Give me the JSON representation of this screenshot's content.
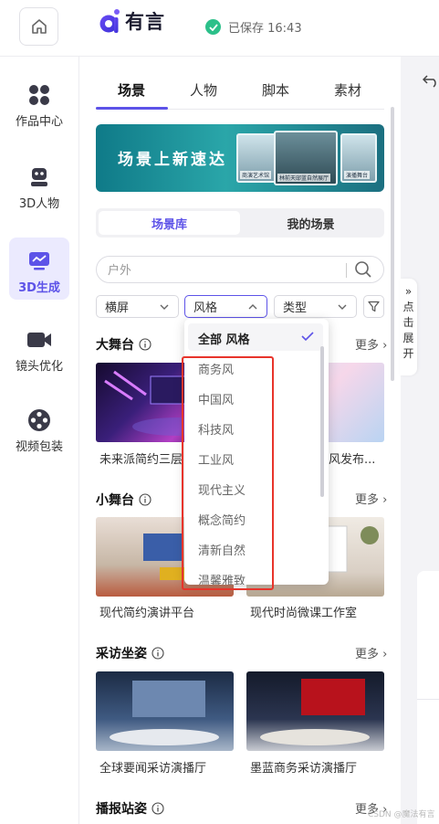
{
  "header": {
    "app_name": "有言",
    "save_status": "已保存 16:43"
  },
  "sidebar": {
    "items": [
      {
        "label": "作品中心",
        "icon": "grid-icon"
      },
      {
        "label": "3D人物",
        "icon": "robot-icon"
      },
      {
        "label": "3D生成",
        "icon": "chart-monitor-icon"
      },
      {
        "label": "镜头优化",
        "icon": "video-camera-icon"
      },
      {
        "label": "视频包装",
        "icon": "film-reel-icon"
      }
    ],
    "active_index": 2
  },
  "tabs": [
    "场景",
    "人物",
    "脚本",
    "素材"
  ],
  "banner": {
    "text": "场景上新速达",
    "cards": [
      "商演艺术馆",
      "林前天邸蓝自然展厅",
      "演播舞台"
    ]
  },
  "segment": {
    "left": "场景库",
    "right": "我的场景"
  },
  "search": {
    "placeholder": "户外"
  },
  "filters": {
    "orientation": "横屏",
    "style": "风格",
    "type": "类型"
  },
  "sections": [
    {
      "title": "大舞台",
      "more": "更多",
      "items": [
        "未来派简约三层",
        "风发布..."
      ]
    },
    {
      "title": "小舞台",
      "more": "更多",
      "items": [
        "现代简约演讲平台",
        "现代时尚微课工作室"
      ]
    },
    {
      "title": "采访坐姿",
      "more": "更多",
      "items": [
        "全球要闻采访演播厅",
        "墨蓝商务采访演播厅"
      ]
    },
    {
      "title": "播报站姿",
      "more": "更多",
      "items": []
    }
  ],
  "style_dropdown": {
    "selected": "全部 风格",
    "options": [
      "商务风",
      "中国风",
      "科技风",
      "工业风",
      "现代主义",
      "概念简约",
      "清新自然",
      "温馨雅致"
    ]
  },
  "side_toggle": {
    "chars": [
      "»",
      "点",
      "击",
      "展",
      "开"
    ]
  },
  "watermark": "CSDN @魔法有言",
  "colors": {
    "accent": "#5d53e8",
    "success": "#2cc08a",
    "highlight_box": "#e8342b"
  }
}
